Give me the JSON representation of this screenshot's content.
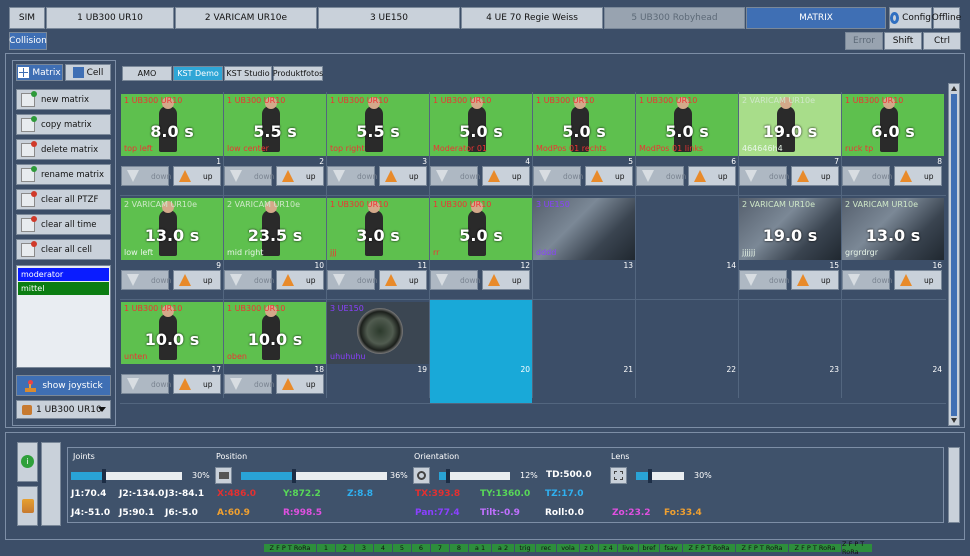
{
  "top_tabs": [
    "SIM",
    "1 UB300 UR10",
    "2 VARICAM UR10e",
    "3 UE150",
    "4 UE 70 Regie Weiss",
    "5 UB300 Robyhead",
    "MATRIX"
  ],
  "config_label": "Config",
  "offline_label": "Offline",
  "collision_label": "Collision",
  "error_label": "Error",
  "shift_label": "Shift",
  "ctrl_label": "Ctrl",
  "mode_tabs": {
    "matrix": "Matrix",
    "cell": "Cell"
  },
  "side_buttons": [
    "new matrix",
    "copy matrix",
    "delete matrix",
    "rename matrix",
    "clear all PTZF",
    "clear all time",
    "clear all cell"
  ],
  "presets": [
    {
      "label": "moderator",
      "color": "#0a1cff"
    },
    {
      "label": "mittel",
      "color": "#0b7d12"
    }
  ],
  "show_joystick": "show joystick",
  "camera_select": "1 UB300 UR10",
  "matrix_tabs": [
    "AMO",
    "KST Demo",
    "KST Studio",
    "Produktfotos"
  ],
  "down_label": "down",
  "up_label": "up",
  "cells": [
    {
      "n": "1",
      "cap": "1 UB300 UR10",
      "time": "8.0 s",
      "bottom": "top left",
      "kind": "green",
      "capc": "red",
      "bc": "red",
      "ctrl": true
    },
    {
      "n": "2",
      "cap": "1 UB300 UR10",
      "time": "5.5 s",
      "bottom": "low center",
      "kind": "green",
      "capc": "red",
      "bc": "red",
      "ctrl": true
    },
    {
      "n": "3",
      "cap": "1 UB300 UR10",
      "time": "5.5 s",
      "bottom": "top right",
      "kind": "green",
      "capc": "red",
      "bc": "red",
      "ctrl": true
    },
    {
      "n": "4",
      "cap": "1 UB300 UR10",
      "time": "5.0 s",
      "bottom": "Moderator 01",
      "kind": "green",
      "capc": "red",
      "bc": "red",
      "ctrl": true
    },
    {
      "n": "5",
      "cap": "1 UB300 UR10",
      "time": "5.0 s",
      "bottom": "ModPos 01 rechts",
      "kind": "green",
      "capc": "red",
      "bc": "red",
      "ctrl": true
    },
    {
      "n": "6",
      "cap": "1 UB300 UR10",
      "time": "5.0 s",
      "bottom": "ModPos 01 links",
      "kind": "green",
      "capc": "red",
      "bc": "red",
      "ctrl": true
    },
    {
      "n": "7",
      "cap": "2 VARICAM UR10e",
      "time": "19.0 s",
      "bottom": "464646h4",
      "kind": "light",
      "capc": "green",
      "bc": "white",
      "ctrl": true
    },
    {
      "n": "8",
      "cap": "1 UB300 UR10",
      "time": "6.0 s",
      "bottom": "ruck tp",
      "kind": "green",
      "capc": "red",
      "bc": "red",
      "ctrl": true
    },
    {
      "n": "9",
      "cap": "2 VARICAM UR10e",
      "time": "13.0 s",
      "bottom": "low left",
      "kind": "green",
      "capc": "green",
      "bc": "white",
      "ctrl": true
    },
    {
      "n": "10",
      "cap": "2 VARICAM UR10e",
      "time": "23.5 s",
      "bottom": "mid right",
      "kind": "green",
      "capc": "green",
      "bc": "white",
      "ctrl": true
    },
    {
      "n": "11",
      "cap": "1 UB300 UR10",
      "time": "3.0 s",
      "bottom": "jjj",
      "kind": "green",
      "capc": "red",
      "bc": "red",
      "ctrl": true
    },
    {
      "n": "12",
      "cap": "1 UB300 UR10",
      "time": "5.0 s",
      "bottom": "rr",
      "kind": "green",
      "capc": "red",
      "bc": "red",
      "ctrl": true
    },
    {
      "n": "13",
      "cap": "3 UE150",
      "time": "",
      "bottom": "dddd",
      "kind": "studio",
      "capc": "purple",
      "bc": "purple",
      "ctrl": false
    },
    {
      "n": "14",
      "cap": "",
      "time": "",
      "bottom": "",
      "kind": "empty",
      "capc": "red",
      "bc": "red",
      "ctrl": false
    },
    {
      "n": "15",
      "cap": "2 VARICAM UR10e",
      "time": "19.0 s",
      "bottom": "jjjjjj",
      "kind": "studio",
      "capc": "green",
      "bc": "white",
      "ctrl": true
    },
    {
      "n": "16",
      "cap": "2 VARICAM UR10e",
      "time": "13.0 s",
      "bottom": "grgrdrgr",
      "kind": "studio",
      "capc": "green",
      "bc": "white",
      "ctrl": true
    },
    {
      "n": "17",
      "cap": "1 UB300 UR10",
      "time": "10.0 s",
      "bottom": "unten",
      "kind": "green",
      "capc": "red",
      "bc": "red",
      "ctrl": true
    },
    {
      "n": "18",
      "cap": "1 UB300 UR10",
      "time": "10.0 s",
      "bottom": "oben",
      "kind": "green",
      "capc": "red",
      "bc": "red",
      "ctrl": true
    },
    {
      "n": "19",
      "cap": "3 UE150",
      "time": "",
      "bottom": "uhuhuhu",
      "kind": "lens",
      "capc": "purple",
      "bc": "purple",
      "ctrl": false
    },
    {
      "n": "20",
      "cap": "",
      "time": "",
      "bottom": "",
      "kind": "selected",
      "capc": "red",
      "bc": "red",
      "ctrl": false
    },
    {
      "n": "21",
      "cap": "",
      "time": "",
      "bottom": "",
      "kind": "empty",
      "capc": "red",
      "bc": "red",
      "ctrl": false
    },
    {
      "n": "22",
      "cap": "",
      "time": "",
      "bottom": "",
      "kind": "empty",
      "capc": "red",
      "bc": "red",
      "ctrl": false
    },
    {
      "n": "23",
      "cap": "",
      "time": "",
      "bottom": "",
      "kind": "empty",
      "capc": "red",
      "bc": "red",
      "ctrl": false
    },
    {
      "n": "24",
      "cap": "",
      "time": "",
      "bottom": "",
      "kind": "empty",
      "capc": "red",
      "bc": "red",
      "ctrl": false
    }
  ],
  "bottom": {
    "joints": "Joints",
    "joints_pct": "30%",
    "joints_fill": 0.3,
    "position": "Position",
    "position_pct": "36%",
    "position_fill": 0.36,
    "orientation": "Orientation",
    "orientation_pct": "12%",
    "orientation_fill": 0.12,
    "td": "TD:500.0",
    "lens": "Lens",
    "lens_pct": "30%",
    "lens_fill": 0.3,
    "j1": "J1:70.4",
    "j2": "J2:-134.0",
    "j3": "J3:-84.1",
    "j4": "J4:-51.0",
    "j5": "J5:90.1",
    "j6": "J6:-5.0",
    "x": "X:486.0",
    "y": "Y:872.2",
    "z": "Z:8.8",
    "a": "A:60.9",
    "r": "R:998.5",
    "tx": "TX:393.8",
    "ty": "TY:1360.0",
    "tz": "TZ:17.0",
    "pan": "Pan:77.4",
    "tilt": "Tilt:-0.9",
    "roll": "Roll:0.0",
    "zo": "Zo:23.2",
    "fo": "Fo:33.4"
  },
  "status_bar": [
    "Z F P T RoRa",
    "1",
    "2",
    "3",
    "4",
    "5",
    "6",
    "7",
    "8",
    "a 1",
    "a 2",
    "trig",
    "rec",
    "vola",
    "z 0",
    "z 4",
    "live",
    "bref",
    "fsav",
    "Z F P T RoRa",
    "Z F P T RoRa",
    "Z F P T RoRa",
    "Z F P T RoRa"
  ]
}
